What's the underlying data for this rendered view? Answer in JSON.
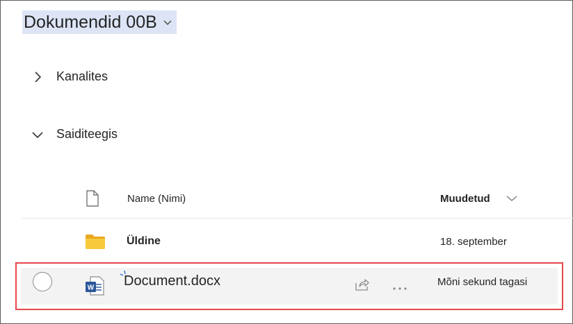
{
  "library": {
    "title": "Dokumendid 00B"
  },
  "sections": [
    {
      "label": "Kanalites",
      "expanded": false
    },
    {
      "label": "Saiditeegis",
      "expanded": true
    }
  ],
  "columns": {
    "name": "Name (Nimi)",
    "modified": "Muudetud"
  },
  "rows": [
    {
      "type": "folder",
      "name": "Üldine",
      "modified": "18. september"
    },
    {
      "type": "word-document",
      "name": "Document.docx",
      "modified": "Mõni sekund tagasi",
      "highlighted": true
    }
  ],
  "colors": {
    "title_highlight": "#dce4f5",
    "folder": "#f7c93b",
    "word": "#2b579a",
    "highlight_border": "#e5474c"
  }
}
